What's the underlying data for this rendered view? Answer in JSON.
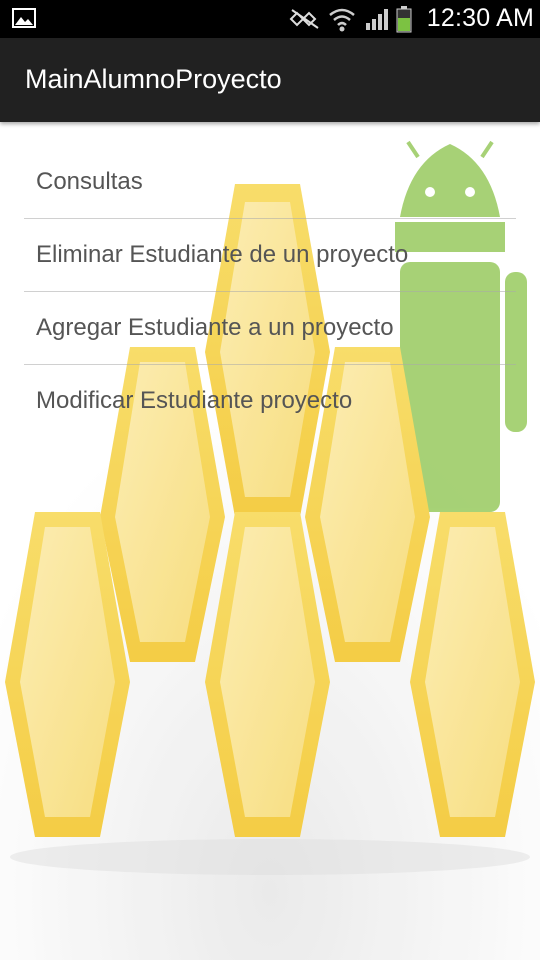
{
  "status_bar": {
    "time": "12:30 AM",
    "icons": [
      "gallery-icon",
      "mute-icon",
      "wifi-icon",
      "signal-icon",
      "battery-icon"
    ]
  },
  "action_bar": {
    "title": "MainAlumnoProyecto"
  },
  "menu": {
    "items": [
      {
        "label": "Consultas"
      },
      {
        "label": "Eliminar Estudiante de un proyecto"
      },
      {
        "label": "Agregar Estudiante a un proyecto"
      },
      {
        "label": "Modificar Estudiante proyecto"
      }
    ]
  },
  "colors": {
    "status_bar": "#000000",
    "action_bar": "#212121",
    "honeycomb": "#F5C518",
    "android_green": "#8BC34A",
    "item_text": "#555555"
  }
}
